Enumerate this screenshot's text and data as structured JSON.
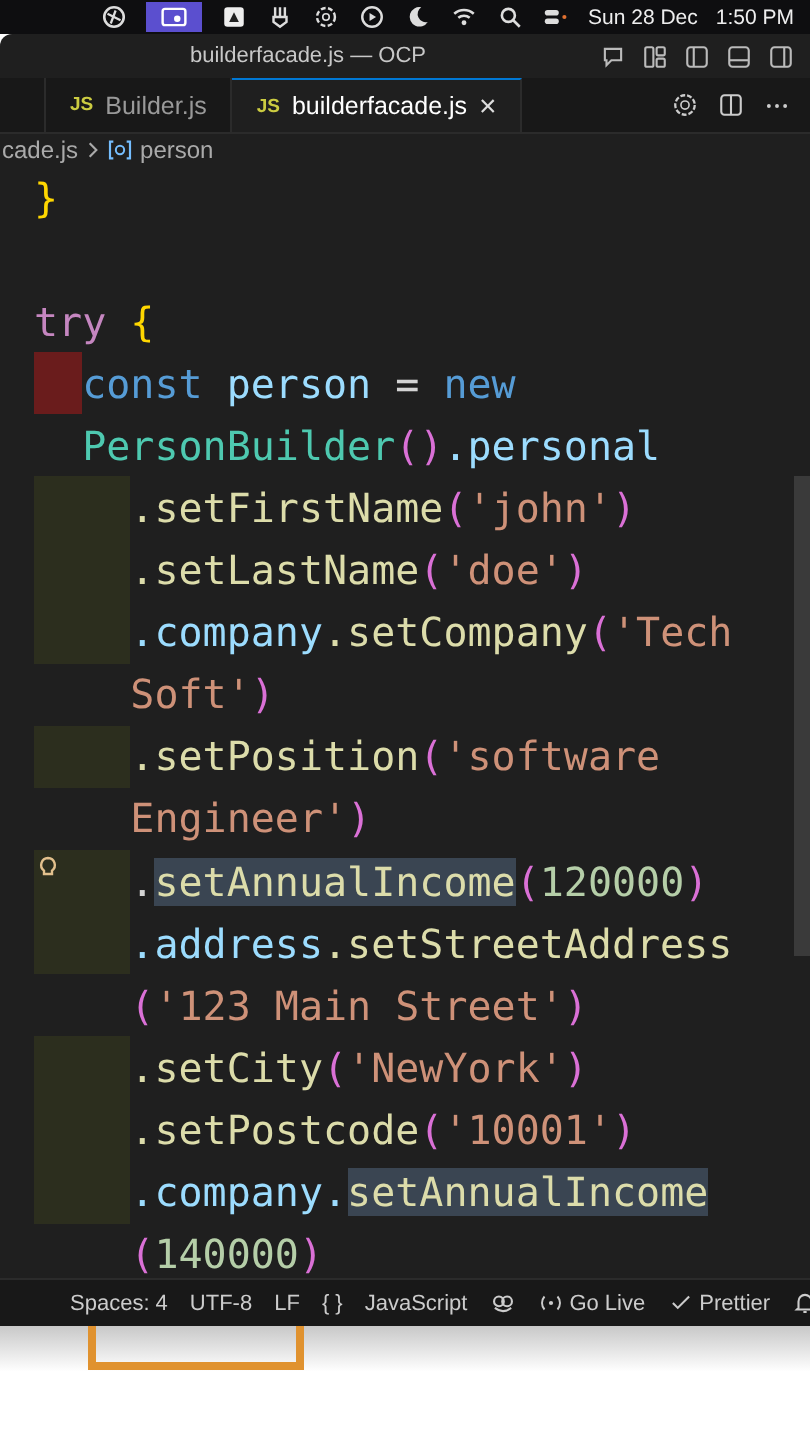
{
  "menu_bar": {
    "date": "Sun 28 Dec",
    "time": "1:50 PM"
  },
  "window": {
    "title": "builderfacade.js — OCP"
  },
  "tabs": [
    {
      "badge": "JS",
      "label": "Builder.js",
      "selected": false
    },
    {
      "badge": "JS",
      "label": "builderfacade.js",
      "selected": true,
      "close": "×"
    }
  ],
  "breadcrumb": {
    "file": "cade.js",
    "symbol": "person"
  },
  "code_lines": [
    {
      "kind": "top",
      "tokens": [
        {
          "kind": "brace",
          "s": "}"
        }
      ]
    },
    {
      "kind": "blank"
    },
    {
      "kind": "top",
      "tokens": [
        {
          "kind": "keyword",
          "s": "try "
        },
        {
          "kind": "brace",
          "s": "{"
        }
      ]
    },
    {
      "kind": "body",
      "color": "#6a1c1c",
      "tokens": [
        {
          "kind": "storage",
          "s": "const "
        },
        {
          "kind": "variable",
          "s": "person "
        },
        {
          "kind": "operator",
          "s": "= "
        },
        {
          "kind": "storage",
          "s": "new"
        }
      ]
    },
    {
      "kind": "body",
      "tokens": [
        {
          "kind": "class",
          "s": "PersonBuilder"
        },
        {
          "kind": "paren",
          "s": "()"
        },
        {
          "kind": "variable",
          "s": ".personal"
        }
      ]
    },
    {
      "kind": "chain",
      "color": "#2c2e1e",
      "tokens": [
        {
          "kind": "method",
          "s": ".setFirstName"
        },
        {
          "kind": "paren",
          "s": "("
        },
        {
          "kind": "string",
          "s": "'john'"
        },
        {
          "kind": "paren",
          "s": ")"
        }
      ]
    },
    {
      "kind": "chain",
      "color": "#2c2e1e",
      "tokens": [
        {
          "kind": "method",
          "s": ".setLastName"
        },
        {
          "kind": "paren",
          "s": "("
        },
        {
          "kind": "string",
          "s": "'doe'"
        },
        {
          "kind": "paren",
          "s": ")"
        }
      ]
    },
    {
      "kind": "chain",
      "color": "#2c2e1e",
      "tokens": [
        {
          "kind": "variable",
          "s": ".company"
        },
        {
          "kind": "method",
          "s": ".setCompany"
        },
        {
          "kind": "paren",
          "s": "("
        },
        {
          "kind": "string",
          "s": "'Tech"
        }
      ]
    },
    {
      "kind": "chain",
      "tokens": [
        {
          "kind": "string",
          "s": "Soft'"
        },
        {
          "kind": "paren",
          "s": ")"
        }
      ]
    },
    {
      "kind": "chain",
      "color": "#2c2e1e",
      "tokens": [
        {
          "kind": "method",
          "s": ".setPosition"
        },
        {
          "kind": "paren",
          "s": "("
        },
        {
          "kind": "string",
          "s": "'software"
        }
      ]
    },
    {
      "kind": "chain",
      "tokens": [
        {
          "kind": "string",
          "s": "Engineer'"
        },
        {
          "kind": "paren",
          "s": ")"
        }
      ]
    },
    {
      "kind": "chain",
      "color": "#2c2e1e",
      "lightbulb": true,
      "tokens": [
        {
          "kind": "operator",
          "s": "."
        },
        {
          "kind": "method",
          "s": "setAnnualIncome",
          "highlight": true
        },
        {
          "kind": "paren",
          "s": "("
        },
        {
          "kind": "number",
          "s": "120000"
        },
        {
          "kind": "paren",
          "s": ")"
        }
      ]
    },
    {
      "kind": "chain",
      "color": "#2c2e1e",
      "tokens": [
        {
          "kind": "variable",
          "s": ".address"
        },
        {
          "kind": "method",
          "s": ".setStreetAddress"
        }
      ]
    },
    {
      "kind": "chain",
      "tokens": [
        {
          "kind": "paren",
          "s": "("
        },
        {
          "kind": "string",
          "s": "'123 Main Street'"
        },
        {
          "kind": "paren",
          "s": ")"
        }
      ]
    },
    {
      "kind": "chain",
      "color": "#2c2e1e",
      "tokens": [
        {
          "kind": "method",
          "s": ".setCity"
        },
        {
          "kind": "paren",
          "s": "("
        },
        {
          "kind": "string",
          "s": "'NewYork'"
        },
        {
          "kind": "paren",
          "s": ")"
        }
      ]
    },
    {
      "kind": "chain",
      "color": "#2c2e1e",
      "tokens": [
        {
          "kind": "method",
          "s": ".setPostcode"
        },
        {
          "kind": "paren",
          "s": "("
        },
        {
          "kind": "string",
          "s": "'10001'"
        },
        {
          "kind": "paren",
          "s": ")"
        }
      ]
    },
    {
      "kind": "chain",
      "color": "#2c2e1e",
      "tokens": [
        {
          "kind": "variable",
          "s": ".company."
        },
        {
          "kind": "method",
          "s": "setAnnualIncome",
          "highlight": true
        }
      ]
    },
    {
      "kind": "chain",
      "tokens": [
        {
          "kind": "paren",
          "s": "("
        },
        {
          "kind": "number",
          "s": "140000"
        },
        {
          "kind": "paren",
          "s": ")"
        }
      ]
    }
  ],
  "status_bar": {
    "spaces": "Spaces: 4",
    "encoding": "UTF-8",
    "eol": "LF",
    "language_braces": "{ }",
    "language": "JavaScript",
    "go_live": "Go Live",
    "prettier": "Prettier"
  }
}
